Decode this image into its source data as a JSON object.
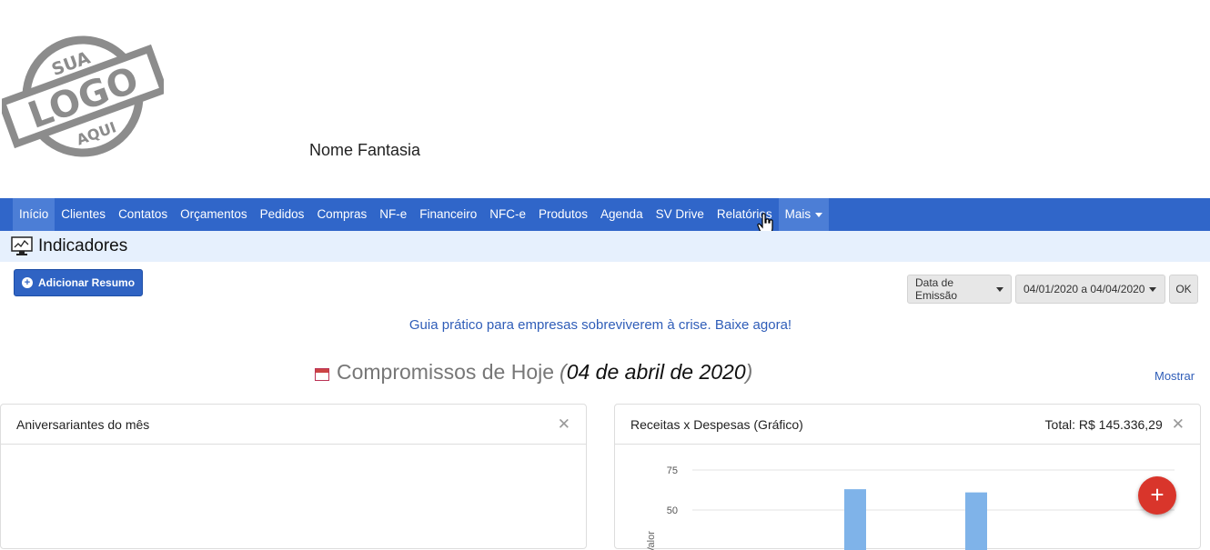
{
  "header": {
    "logo_text_top": "SUA",
    "logo_text_middle": "LOGO",
    "logo_text_bottom": "AQUI",
    "company_name": "Nome Fantasia"
  },
  "nav": {
    "items": [
      "Início",
      "Clientes",
      "Contatos",
      "Orçamentos",
      "Pedidos",
      "Compras",
      "NF-e",
      "Financeiro",
      "NFC-e",
      "Produtos",
      "Agenda",
      "SV Drive",
      "Relatórios",
      "Mais"
    ],
    "active": "Início"
  },
  "page": {
    "title": "Indicadores"
  },
  "toolbar": {
    "add_summary": "Adicionar Resumo",
    "date_type": "Data de Emissão",
    "date_range": "04/01/2020 a 04/04/2020",
    "ok": "OK"
  },
  "promo": "Guia prático para empresas sobreviverem à crise. Baixe agora!",
  "appointments": {
    "title": "Compromissos de Hoje",
    "date": "04 de abril de 2020",
    "show": "Mostrar"
  },
  "panels": {
    "birthdays": {
      "title": "Aniversariantes do mês"
    },
    "revenue": {
      "title": "Receitas x Despesas (Gráfico)",
      "total": "Total: R$ 145.336,29"
    }
  },
  "chart_data": {
    "type": "bar",
    "title": "",
    "ylabel": "Valor",
    "yticks": [
      50,
      75
    ],
    "ylim_visible": [
      25,
      80
    ],
    "series": [
      {
        "values": [
          63,
          61
        ]
      }
    ]
  },
  "colors": {
    "nav": "#3066c9",
    "accent": "#2f5db8",
    "fab": "#d9352b",
    "bar": "#7fb3e9"
  },
  "icons": {
    "fab": "plus-icon",
    "indicators": "monitor-chart-icon",
    "appointments": "calendar-icon"
  }
}
